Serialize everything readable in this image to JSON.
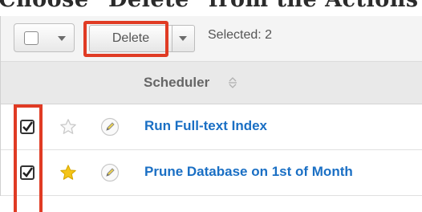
{
  "caption": "Choose \"Delete\" from the Actions",
  "toolbar": {
    "delete_label": "Delete",
    "selected_label": "Selected: 2"
  },
  "table": {
    "column_header": "Scheduler",
    "rows": [
      {
        "name": "Run Full-text Index",
        "checked": true,
        "favorite": false
      },
      {
        "name": "Prune Database on 1st of Month",
        "checked": true,
        "favorite": true
      }
    ]
  },
  "icons": {
    "sort": "sort-icon",
    "favorite": "star-icon",
    "edit": "pencil-icon",
    "dropdown": "chevron-down-icon"
  },
  "colors": {
    "highlight": "#e03b24",
    "link": "#1a6fc4",
    "favorite_star": "#f5c518"
  }
}
